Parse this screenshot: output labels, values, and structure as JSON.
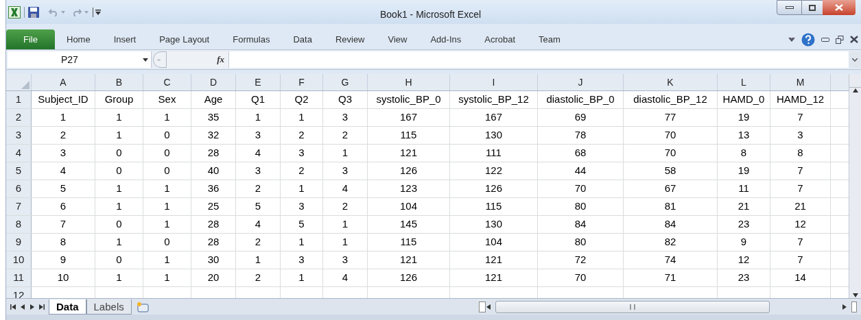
{
  "window": {
    "title": "Book1  -  Microsoft Excel"
  },
  "ribbon_tabs": [
    {
      "label": "File",
      "kind": "file",
      "selected": false
    },
    {
      "label": "Home",
      "kind": "tab",
      "selected": false
    },
    {
      "label": "Insert",
      "kind": "tab",
      "selected": false
    },
    {
      "label": "Page Layout",
      "kind": "tab",
      "selected": false
    },
    {
      "label": "Formulas",
      "kind": "tab",
      "selected": false
    },
    {
      "label": "Data",
      "kind": "tab",
      "selected": false
    },
    {
      "label": "Review",
      "kind": "tab",
      "selected": false
    },
    {
      "label": "View",
      "kind": "tab",
      "selected": false
    },
    {
      "label": "Add-Ins",
      "kind": "tab",
      "selected": false
    },
    {
      "label": "Acrobat",
      "kind": "tab",
      "selected": false
    },
    {
      "label": "Team",
      "kind": "tab",
      "selected": false
    }
  ],
  "formula_bar": {
    "name_box": "P27",
    "fx": "fx"
  },
  "sheet": {
    "columns": [
      "A",
      "B",
      "C",
      "D",
      "E",
      "F",
      "G",
      "H",
      "I",
      "J",
      "K",
      "L",
      "M"
    ],
    "rows": [
      {
        "number": "1",
        "cells": [
          "Subject_ID",
          "Group",
          "Sex",
          "Age",
          "Q1",
          "Q2",
          "Q3",
          "systolic_BP_0",
          "systolic_BP_12",
          "diastolic_BP_0",
          "diastolic_BP_12",
          "HAMD_0",
          "HAMD_12"
        ]
      },
      {
        "number": "2",
        "cells": [
          "1",
          "1",
          "1",
          "35",
          "1",
          "1",
          "3",
          "167",
          "167",
          "69",
          "77",
          "19",
          "7"
        ]
      },
      {
        "number": "3",
        "cells": [
          "2",
          "1",
          "0",
          "32",
          "3",
          "2",
          "2",
          "115",
          "130",
          "78",
          "70",
          "13",
          "3"
        ]
      },
      {
        "number": "4",
        "cells": [
          "3",
          "0",
          "0",
          "28",
          "4",
          "3",
          "1",
          "121",
          "111",
          "68",
          "70",
          "8",
          "8"
        ]
      },
      {
        "number": "5",
        "cells": [
          "4",
          "0",
          "0",
          "40",
          "3",
          "2",
          "3",
          "126",
          "122",
          "44",
          "58",
          "19",
          "7"
        ]
      },
      {
        "number": "6",
        "cells": [
          "5",
          "1",
          "1",
          "36",
          "2",
          "1",
          "4",
          "123",
          "126",
          "70",
          "67",
          "11",
          "7"
        ]
      },
      {
        "number": "7",
        "cells": [
          "6",
          "1",
          "1",
          "25",
          "5",
          "3",
          "2",
          "104",
          "115",
          "80",
          "81",
          "21",
          "21"
        ]
      },
      {
        "number": "8",
        "cells": [
          "7",
          "0",
          "1",
          "28",
          "4",
          "5",
          "1",
          "145",
          "130",
          "84",
          "84",
          "23",
          "12"
        ]
      },
      {
        "number": "9",
        "cells": [
          "8",
          "1",
          "0",
          "28",
          "2",
          "1",
          "1",
          "115",
          "104",
          "80",
          "82",
          "9",
          "7"
        ]
      },
      {
        "number": "10",
        "cells": [
          "9",
          "0",
          "1",
          "30",
          "1",
          "3",
          "3",
          "121",
          "121",
          "72",
          "74",
          "12",
          "7"
        ]
      },
      {
        "number": "11",
        "cells": [
          "10",
          "1",
          "1",
          "20",
          "2",
          "1",
          "4",
          "126",
          "121",
          "70",
          "71",
          "23",
          "14"
        ]
      },
      {
        "number": "12",
        "cells": [
          "",
          "",
          "",
          "",
          "",
          "",
          "",
          "",
          "",
          "",
          "",
          "",
          ""
        ]
      }
    ]
  },
  "sheet_tabs": [
    {
      "label": "Data",
      "selected": true
    },
    {
      "label": "Labels",
      "selected": false
    }
  ]
}
